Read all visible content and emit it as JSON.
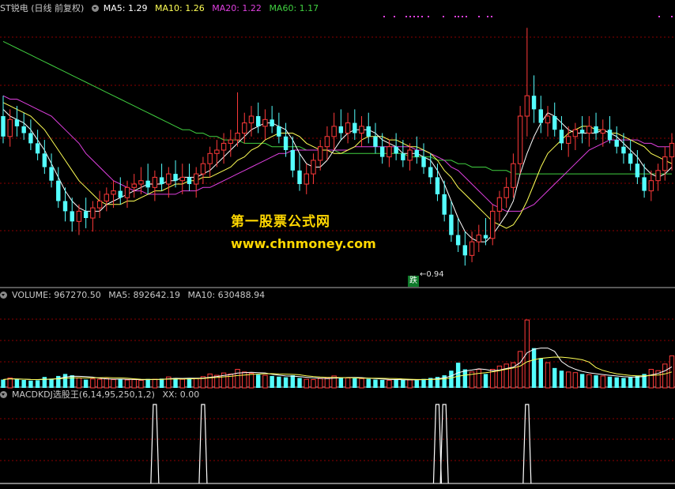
{
  "header": {
    "title": "ST锐电 (日线 前复权)",
    "ma5": "MA5: 1.29",
    "ma10": "MA10: 1.26",
    "ma20": "MA20: 1.22",
    "ma60": "MA60: 1.17"
  },
  "volume_header": {
    "label": "VOLUME: 967270.50",
    "ma5": "MA5: 892642.19",
    "ma10": "MA10: 630488.94"
  },
  "indicator_header": {
    "label": "MACDKDJ选股王(6,14,95,250,1,2)",
    "xx": "XX: 0.00"
  },
  "watermark": {
    "line1": "第一股票公式网",
    "line2": "www.chnmoney.com"
  },
  "low_marker": {
    "tag": "跌",
    "value": "←0.94"
  },
  "colors": {
    "up": "#ff3a3a",
    "down": "#54ffff",
    "ma5": "#ffffff",
    "ma10": "#ffff55",
    "ma20": "#e040e0",
    "ma60": "#40d040",
    "grid": "#8b0000",
    "bg": "#000000"
  },
  "chart_data": [
    {
      "type": "candlestick",
      "title": "ST锐电 (日线 前复权)",
      "min_low_label": 0.94,
      "ylim": [
        0.88,
        1.68
      ],
      "ohlc": [
        [
          1.38,
          1.44,
          1.3,
          1.32
        ],
        [
          1.32,
          1.4,
          1.29,
          1.37
        ],
        [
          1.37,
          1.41,
          1.32,
          1.35
        ],
        [
          1.35,
          1.39,
          1.31,
          1.33
        ],
        [
          1.33,
          1.37,
          1.28,
          1.3
        ],
        [
          1.3,
          1.34,
          1.25,
          1.27
        ],
        [
          1.27,
          1.31,
          1.21,
          1.23
        ],
        [
          1.23,
          1.27,
          1.17,
          1.19
        ],
        [
          1.19,
          1.23,
          1.11,
          1.13
        ],
        [
          1.13,
          1.17,
          1.07,
          1.1
        ],
        [
          1.1,
          1.14,
          1.04,
          1.07
        ],
        [
          1.07,
          1.12,
          1.03,
          1.1
        ],
        [
          1.1,
          1.14,
          1.05,
          1.08
        ],
        [
          1.08,
          1.13,
          1.04,
          1.11
        ],
        [
          1.11,
          1.16,
          1.08,
          1.13
        ],
        [
          1.13,
          1.17,
          1.1,
          1.15
        ],
        [
          1.15,
          1.19,
          1.11,
          1.16
        ],
        [
          1.16,
          1.2,
          1.12,
          1.14
        ],
        [
          1.14,
          1.19,
          1.11,
          1.17
        ],
        [
          1.17,
          1.21,
          1.14,
          1.18
        ],
        [
          1.18,
          1.23,
          1.15,
          1.19
        ],
        [
          1.19,
          1.24,
          1.15,
          1.17
        ],
        [
          1.17,
          1.22,
          1.13,
          1.2
        ],
        [
          1.2,
          1.24,
          1.16,
          1.18
        ],
        [
          1.18,
          1.23,
          1.14,
          1.21
        ],
        [
          1.21,
          1.25,
          1.17,
          1.19
        ],
        [
          1.19,
          1.24,
          1.15,
          1.2
        ],
        [
          1.2,
          1.24,
          1.16,
          1.18
        ],
        [
          1.18,
          1.23,
          1.14,
          1.21
        ],
        [
          1.21,
          1.26,
          1.18,
          1.24
        ],
        [
          1.24,
          1.29,
          1.2,
          1.27
        ],
        [
          1.27,
          1.31,
          1.23,
          1.28
        ],
        [
          1.28,
          1.33,
          1.24,
          1.3
        ],
        [
          1.3,
          1.34,
          1.26,
          1.31
        ],
        [
          1.31,
          1.45,
          1.29,
          1.33
        ],
        [
          1.33,
          1.39,
          1.3,
          1.36
        ],
        [
          1.36,
          1.41,
          1.32,
          1.38
        ],
        [
          1.38,
          1.42,
          1.33,
          1.35
        ],
        [
          1.35,
          1.4,
          1.31,
          1.37
        ],
        [
          1.37,
          1.41,
          1.33,
          1.35
        ],
        [
          1.35,
          1.39,
          1.3,
          1.32
        ],
        [
          1.32,
          1.36,
          1.26,
          1.28
        ],
        [
          1.28,
          1.32,
          1.2,
          1.22
        ],
        [
          1.22,
          1.27,
          1.16,
          1.18
        ],
        [
          1.18,
          1.24,
          1.15,
          1.21
        ],
        [
          1.21,
          1.27,
          1.18,
          1.25
        ],
        [
          1.25,
          1.31,
          1.22,
          1.29
        ],
        [
          1.29,
          1.35,
          1.25,
          1.32
        ],
        [
          1.32,
          1.39,
          1.28,
          1.35
        ],
        [
          1.35,
          1.4,
          1.31,
          1.33
        ],
        [
          1.33,
          1.39,
          1.3,
          1.36
        ],
        [
          1.36,
          1.4,
          1.31,
          1.33
        ],
        [
          1.33,
          1.38,
          1.29,
          1.35
        ],
        [
          1.35,
          1.39,
          1.3,
          1.32
        ],
        [
          1.32,
          1.36,
          1.27,
          1.29
        ],
        [
          1.29,
          1.33,
          1.24,
          1.26
        ],
        [
          1.26,
          1.31,
          1.23,
          1.29
        ],
        [
          1.29,
          1.33,
          1.25,
          1.27
        ],
        [
          1.27,
          1.31,
          1.23,
          1.25
        ],
        [
          1.25,
          1.3,
          1.22,
          1.28
        ],
        [
          1.28,
          1.32,
          1.24,
          1.26
        ],
        [
          1.26,
          1.3,
          1.21,
          1.23
        ],
        [
          1.23,
          1.27,
          1.18,
          1.2
        ],
        [
          1.2,
          1.24,
          1.13,
          1.15
        ],
        [
          1.15,
          1.19,
          1.07,
          1.09
        ],
        [
          1.09,
          1.13,
          1.01,
          1.03
        ],
        [
          1.03,
          1.08,
          0.98,
          1.0
        ],
        [
          1.0,
          1.04,
          0.94,
          0.97
        ],
        [
          0.97,
          1.04,
          0.95,
          1.01
        ],
        [
          1.01,
          1.06,
          0.98,
          1.03
        ],
        [
          1.03,
          1.08,
          1.0,
          1.02
        ],
        [
          1.02,
          1.12,
          1.0,
          1.1
        ],
        [
          1.1,
          1.16,
          1.07,
          1.14
        ],
        [
          1.14,
          1.2,
          1.11,
          1.17
        ],
        [
          1.17,
          1.27,
          1.14,
          1.24
        ],
        [
          1.24,
          1.41,
          1.21,
          1.38
        ],
        [
          1.38,
          1.64,
          1.32,
          1.44
        ],
        [
          1.44,
          1.5,
          1.36,
          1.4
        ],
        [
          1.4,
          1.44,
          1.33,
          1.36
        ],
        [
          1.36,
          1.41,
          1.32,
          1.38
        ],
        [
          1.38,
          1.42,
          1.32,
          1.34
        ],
        [
          1.34,
          1.38,
          1.28,
          1.3
        ],
        [
          1.3,
          1.35,
          1.26,
          1.32
        ],
        [
          1.32,
          1.36,
          1.28,
          1.34
        ],
        [
          1.34,
          1.38,
          1.3,
          1.33
        ],
        [
          1.33,
          1.38,
          1.29,
          1.35
        ],
        [
          1.35,
          1.39,
          1.31,
          1.33
        ],
        [
          1.33,
          1.37,
          1.29,
          1.34
        ],
        [
          1.34,
          1.38,
          1.3,
          1.31
        ],
        [
          1.31,
          1.35,
          1.27,
          1.29
        ],
        [
          1.29,
          1.33,
          1.24,
          1.27
        ],
        [
          1.27,
          1.31,
          1.22,
          1.24
        ],
        [
          1.24,
          1.28,
          1.18,
          1.2
        ],
        [
          1.2,
          1.24,
          1.14,
          1.16
        ],
        [
          1.16,
          1.22,
          1.13,
          1.19
        ],
        [
          1.19,
          1.24,
          1.16,
          1.22
        ],
        [
          1.22,
          1.29,
          1.19,
          1.26
        ],
        [
          1.26,
          1.33,
          1.22,
          1.3
        ]
      ],
      "series": [
        {
          "name": "MA5",
          "values": [
            1.4,
            1.38,
            1.37,
            1.36,
            1.34,
            1.31,
            1.28,
            1.24,
            1.2,
            1.16,
            1.13,
            1.11,
            1.1,
            1.1,
            1.1,
            1.12,
            1.13,
            1.14,
            1.15,
            1.16,
            1.17,
            1.18,
            1.18,
            1.18,
            1.19,
            1.19,
            1.2,
            1.2,
            1.2,
            1.21,
            1.22,
            1.24,
            1.26,
            1.28,
            1.3,
            1.32,
            1.34,
            1.35,
            1.36,
            1.36,
            1.35,
            1.34,
            1.31,
            1.27,
            1.24,
            1.23,
            1.23,
            1.25,
            1.28,
            1.31,
            1.33,
            1.34,
            1.34,
            1.34,
            1.33,
            1.31,
            1.3,
            1.29,
            1.27,
            1.27,
            1.27,
            1.26,
            1.25,
            1.22,
            1.18,
            1.13,
            1.08,
            1.04,
            1.02,
            1.01,
            1.01,
            1.03,
            1.06,
            1.09,
            1.13,
            1.21,
            1.27,
            1.32,
            1.36,
            1.39,
            1.38,
            1.36,
            1.34,
            1.33,
            1.33,
            1.33,
            1.33,
            1.34,
            1.33,
            1.32,
            1.3,
            1.28,
            1.26,
            1.23,
            1.21,
            1.2,
            1.21,
            1.23
          ]
        },
        {
          "name": "MA10",
          "values": [
            1.42,
            1.41,
            1.4,
            1.39,
            1.38,
            1.36,
            1.34,
            1.31,
            1.28,
            1.25,
            1.22,
            1.19,
            1.17,
            1.15,
            1.13,
            1.12,
            1.12,
            1.12,
            1.13,
            1.13,
            1.14,
            1.15,
            1.16,
            1.16,
            1.17,
            1.18,
            1.18,
            1.19,
            1.19,
            1.2,
            1.2,
            1.21,
            1.22,
            1.23,
            1.25,
            1.26,
            1.28,
            1.29,
            1.31,
            1.32,
            1.33,
            1.33,
            1.33,
            1.32,
            1.3,
            1.29,
            1.28,
            1.28,
            1.27,
            1.27,
            1.28,
            1.29,
            1.31,
            1.32,
            1.32,
            1.32,
            1.31,
            1.31,
            1.3,
            1.29,
            1.29,
            1.28,
            1.27,
            1.25,
            1.22,
            1.2,
            1.17,
            1.15,
            1.13,
            1.11,
            1.09,
            1.07,
            1.06,
            1.05,
            1.06,
            1.09,
            1.13,
            1.18,
            1.23,
            1.27,
            1.29,
            1.31,
            1.33,
            1.34,
            1.35,
            1.35,
            1.34,
            1.34,
            1.33,
            1.33,
            1.32,
            1.31,
            1.3,
            1.29,
            1.27,
            1.26,
            1.25,
            1.24
          ]
        },
        {
          "name": "MA20",
          "values": [
            1.44,
            1.43,
            1.43,
            1.42,
            1.41,
            1.4,
            1.39,
            1.38,
            1.36,
            1.34,
            1.32,
            1.3,
            1.27,
            1.25,
            1.23,
            1.21,
            1.19,
            1.18,
            1.17,
            1.16,
            1.16,
            1.15,
            1.15,
            1.15,
            1.15,
            1.15,
            1.16,
            1.16,
            1.16,
            1.17,
            1.17,
            1.18,
            1.19,
            1.2,
            1.21,
            1.22,
            1.23,
            1.24,
            1.25,
            1.26,
            1.27,
            1.27,
            1.28,
            1.28,
            1.28,
            1.28,
            1.28,
            1.28,
            1.28,
            1.28,
            1.28,
            1.29,
            1.29,
            1.29,
            1.29,
            1.29,
            1.29,
            1.29,
            1.29,
            1.29,
            1.28,
            1.28,
            1.27,
            1.26,
            1.25,
            1.23,
            1.22,
            1.2,
            1.18,
            1.16,
            1.14,
            1.12,
            1.11,
            1.1,
            1.1,
            1.1,
            1.11,
            1.12,
            1.14,
            1.16,
            1.18,
            1.2,
            1.22,
            1.24,
            1.26,
            1.28,
            1.29,
            1.3,
            1.31,
            1.31,
            1.31,
            1.31,
            1.31,
            1.3,
            1.3,
            1.29,
            1.29,
            1.29
          ]
        },
        {
          "name": "MA60",
          "values": [
            1.6,
            1.59,
            1.58,
            1.57,
            1.56,
            1.55,
            1.54,
            1.53,
            1.52,
            1.51,
            1.5,
            1.49,
            1.48,
            1.47,
            1.46,
            1.45,
            1.44,
            1.43,
            1.42,
            1.41,
            1.4,
            1.39,
            1.38,
            1.37,
            1.36,
            1.35,
            1.34,
            1.34,
            1.33,
            1.33,
            1.32,
            1.32,
            1.31,
            1.31,
            1.31,
            1.3,
            1.3,
            1.3,
            1.3,
            1.29,
            1.29,
            1.29,
            1.29,
            1.29,
            1.28,
            1.28,
            1.28,
            1.28,
            1.28,
            1.27,
            1.27,
            1.27,
            1.27,
            1.27,
            1.27,
            1.27,
            1.27,
            1.27,
            1.27,
            1.26,
            1.26,
            1.26,
            1.26,
            1.25,
            1.25,
            1.25,
            1.24,
            1.24,
            1.23,
            1.23,
            1.23,
            1.22,
            1.22,
            1.22,
            1.21,
            1.21,
            1.21,
            1.21,
            1.21,
            1.21,
            1.21,
            1.21,
            1.21,
            1.21,
            1.21,
            1.21,
            1.21,
            1.21,
            1.21,
            1.21,
            1.21,
            1.21,
            1.21,
            1.21,
            1.21,
            1.21,
            1.21,
            1.21
          ]
        }
      ]
    },
    {
      "type": "bar",
      "title": "VOLUME",
      "ylim": [
        0,
        2600000
      ],
      "values": [
        250000,
        300000,
        260000,
        240000,
        220000,
        230000,
        330000,
        280000,
        360000,
        420000,
        380000,
        300000,
        250000,
        270000,
        260000,
        280000,
        250000,
        260000,
        240000,
        250000,
        230000,
        270000,
        260000,
        280000,
        330000,
        300000,
        260000,
        300000,
        280000,
        340000,
        420000,
        380000,
        450000,
        420000,
        560000,
        480000,
        440000,
        400000,
        380000,
        360000,
        340000,
        320000,
        380000,
        300000,
        260000,
        250000,
        280000,
        300000,
        360000,
        320000,
        300000,
        290000,
        280000,
        270000,
        250000,
        240000,
        230000,
        260000,
        250000,
        240000,
        230000,
        270000,
        300000,
        330000,
        380000,
        520000,
        760000,
        560000,
        480000,
        560000,
        420000,
        560000,
        660000,
        720000,
        760000,
        1100000,
        2050000,
        1200000,
        900000,
        760000,
        600000,
        520000,
        480000,
        460000,
        420000,
        400000,
        380000,
        360000,
        340000,
        320000,
        300000,
        320000,
        360000,
        420000,
        560000,
        520000,
        720000,
        967270.5
      ]
    },
    {
      "type": "line",
      "title": "MACDKDJ选股王(6,14,95,250,1,2)",
      "ylim": [
        0,
        1
      ],
      "signal_bars": [
        22,
        29,
        63,
        64,
        76
      ],
      "x": [],
      "values": []
    }
  ]
}
